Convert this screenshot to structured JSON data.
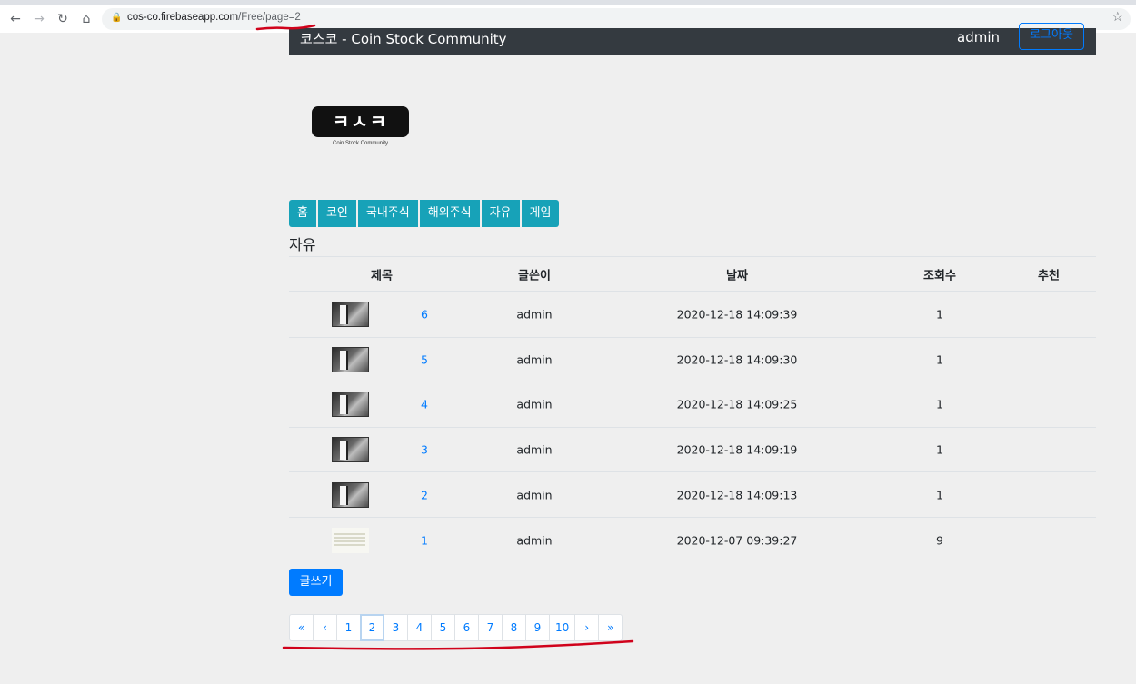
{
  "browser": {
    "url_host": "cos-co.firebaseapp.com",
    "url_path": "/Free/page=2"
  },
  "header": {
    "brand": "코스코 - Coin Stock Community",
    "user": "admin",
    "logout_label": "로그아웃"
  },
  "logo": {
    "main": "ㅋㅅㅋ",
    "sub": "Coin Stock Community"
  },
  "nav": {
    "items": [
      "홈",
      "코인",
      "국내주식",
      "해외주식",
      "자유",
      "게임"
    ]
  },
  "section_title": "자유",
  "table": {
    "headers": {
      "title": "제목",
      "writer": "글쓴이",
      "date": "날짜",
      "views": "조회수",
      "recommend": "추천"
    },
    "rows": [
      {
        "num": "6",
        "writer": "admin",
        "date": "2020-12-18 14:09:39",
        "views": "1",
        "recommend": ""
      },
      {
        "num": "5",
        "writer": "admin",
        "date": "2020-12-18 14:09:30",
        "views": "1",
        "recommend": ""
      },
      {
        "num": "4",
        "writer": "admin",
        "date": "2020-12-18 14:09:25",
        "views": "1",
        "recommend": ""
      },
      {
        "num": "3",
        "writer": "admin",
        "date": "2020-12-18 14:09:19",
        "views": "1",
        "recommend": ""
      },
      {
        "num": "2",
        "writer": "admin",
        "date": "2020-12-18 14:09:13",
        "views": "1",
        "recommend": ""
      },
      {
        "num": "1",
        "writer": "admin",
        "date": "2020-12-07 09:39:27",
        "views": "9",
        "recommend": ""
      }
    ]
  },
  "write_label": "글쓰기",
  "pagination": {
    "first": "«",
    "prev": "‹",
    "pages": [
      "1",
      "2",
      "3",
      "4",
      "5",
      "6",
      "7",
      "8",
      "9",
      "10"
    ],
    "next": "›",
    "last": "»",
    "current": "2"
  },
  "colors": {
    "header_bg": "#343a40",
    "nav_bg": "#17a2b8",
    "primary": "#007bff",
    "annotation": "#d0021b"
  }
}
